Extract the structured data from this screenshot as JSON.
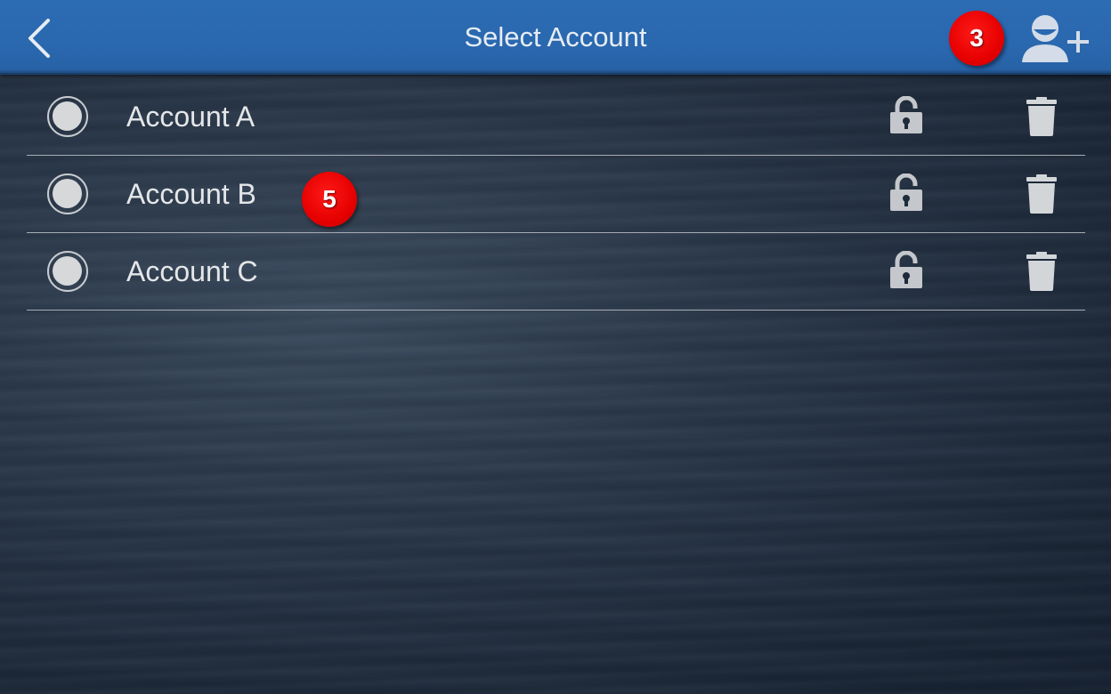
{
  "header": {
    "title": "Select Account",
    "back_icon": "chevron-left-icon",
    "add_user_icon": "add-user-icon"
  },
  "annotations": {
    "badge_header": "3",
    "badge_row": "5",
    "badge_color": "#e60000"
  },
  "accounts": [
    {
      "name": "Account A",
      "selected": false,
      "lock_icon": "unlock-icon",
      "delete_icon": "trash-icon"
    },
    {
      "name": "Account B",
      "selected": false,
      "lock_icon": "unlock-icon",
      "delete_icon": "trash-icon"
    },
    {
      "name": "Account C",
      "selected": false,
      "lock_icon": "unlock-icon",
      "delete_icon": "trash-icon"
    }
  ],
  "colors": {
    "header_bg": "#2a68af",
    "icon_light": "#d3dce8",
    "row_icon": "#c4c7cb"
  }
}
